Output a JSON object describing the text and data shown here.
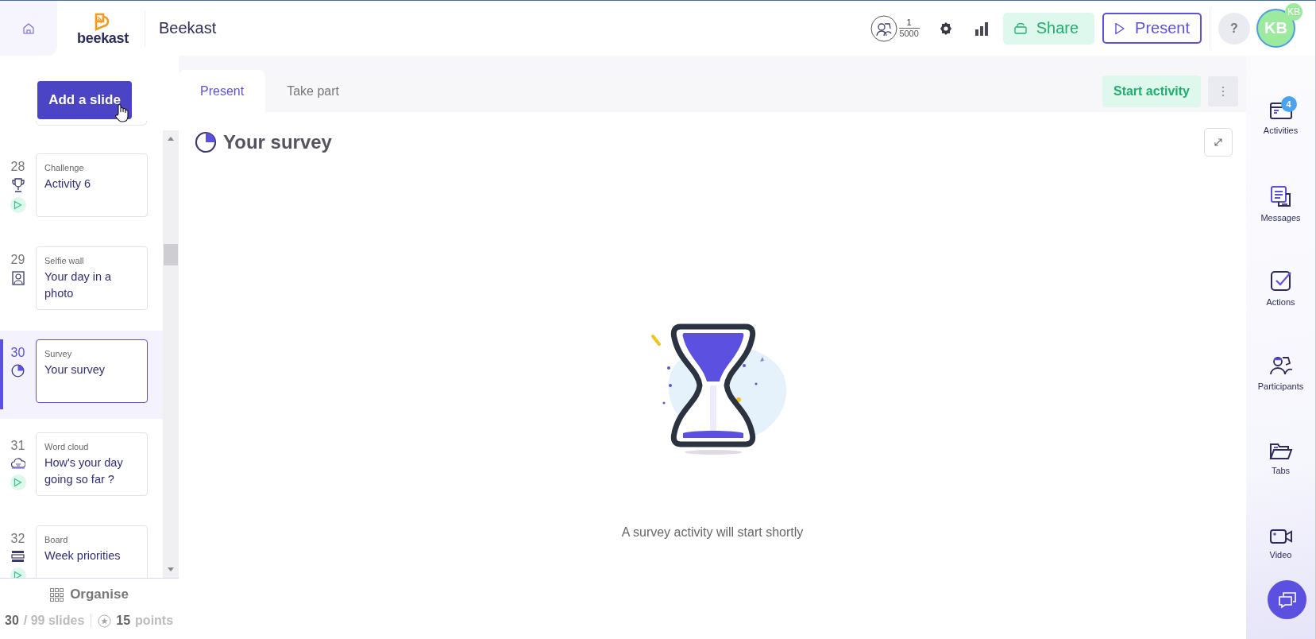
{
  "header": {
    "logo_text": "beekast",
    "title": "Beekast",
    "participants_count": "1",
    "participants_max": "5000",
    "share": "Share",
    "present": "Present",
    "help": "?",
    "avatar": "KB",
    "avatar_badge": "KB"
  },
  "sidebar": {
    "add_button": "Add a slide",
    "slides": [
      {
        "number": "28",
        "kind": "challenge",
        "type_label": "Challenge",
        "title": "Activity 6",
        "playable": true,
        "selected": false
      },
      {
        "number": "29",
        "kind": "selfie",
        "type_label": "Selfie wall",
        "title": "Your day in a photo",
        "playable": false,
        "selected": false
      },
      {
        "number": "30",
        "kind": "survey",
        "type_label": "Survey",
        "title": "Your survey",
        "playable": false,
        "selected": true
      },
      {
        "number": "31",
        "kind": "wordcloud",
        "type_label": "Word cloud",
        "title": "How's your day going so far ?",
        "playable": true,
        "selected": false
      },
      {
        "number": "32",
        "kind": "board",
        "type_label": "Board",
        "title": "Week priorities",
        "playable": true,
        "selected": false
      }
    ],
    "organise": "Organise",
    "slide_current": "30",
    "slide_total": "/ 99 slides",
    "points": "15",
    "points_label": "points"
  },
  "main": {
    "tabs": [
      {
        "label": "Present",
        "selected": true
      },
      {
        "label": "Take part",
        "selected": false
      }
    ],
    "start_button": "Start activity",
    "activity_title": "Your survey",
    "message": "A survey activity will start shortly"
  },
  "right_panel": {
    "items": [
      {
        "kind": "activities",
        "label": "Activities",
        "badge": "4"
      },
      {
        "kind": "messages",
        "label": "Messages"
      },
      {
        "kind": "actions",
        "label": "Actions"
      },
      {
        "kind": "participants",
        "label": "Participants"
      },
      {
        "kind": "tabs",
        "label": "Tabs"
      },
      {
        "kind": "video",
        "label": "Video"
      }
    ]
  }
}
